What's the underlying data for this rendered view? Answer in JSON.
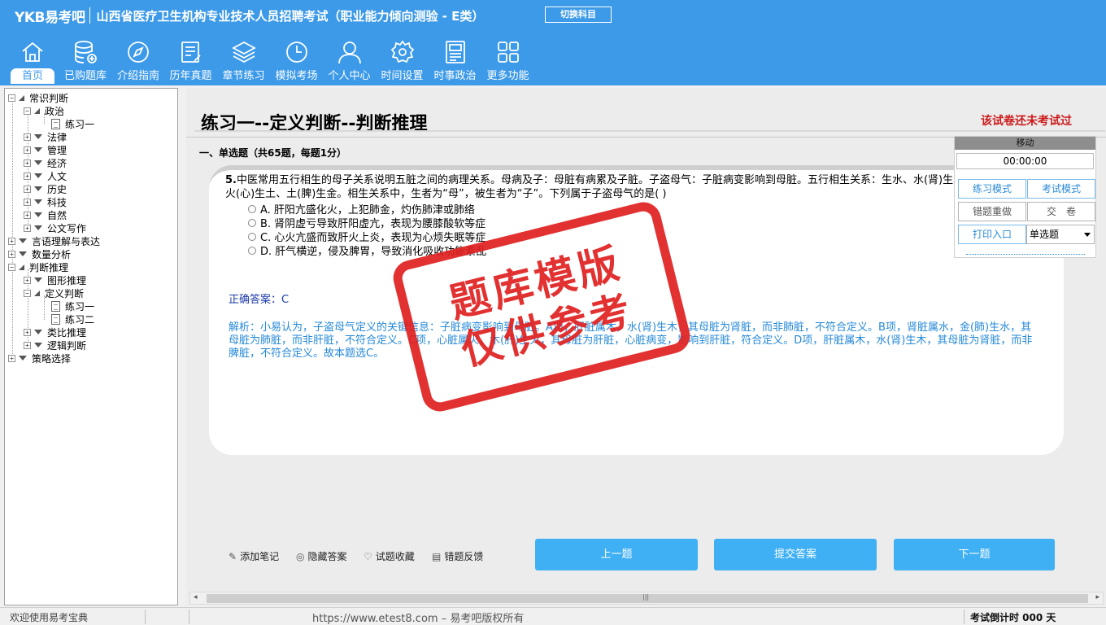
{
  "header": {
    "logo": "YKB易考吧",
    "title": "山西省医疗卫生机构专业技术人员招聘考试（职业能力倾向测验 - E类）",
    "switch_button": "切换科目"
  },
  "nav": [
    {
      "label": "首页",
      "icon": "home-icon"
    },
    {
      "label": "已购题库",
      "icon": "database-icon"
    },
    {
      "label": "介绍指南",
      "icon": "compass-icon"
    },
    {
      "label": "历年真题",
      "icon": "document-icon"
    },
    {
      "label": "章节练习",
      "icon": "layers-icon"
    },
    {
      "label": "模拟考场",
      "icon": "clock-icon"
    },
    {
      "label": "个人中心",
      "icon": "user-icon"
    },
    {
      "label": "时间设置",
      "icon": "gear-icon"
    },
    {
      "label": "时事政治",
      "icon": "newspaper-icon"
    },
    {
      "label": "更多功能",
      "icon": "grid-icon"
    }
  ],
  "tree": [
    {
      "label": "常识判断",
      "level": 0,
      "state": "open"
    },
    {
      "label": "政治",
      "level": 1,
      "state": "open"
    },
    {
      "label": "练习一",
      "level": 2,
      "state": "leaf"
    },
    {
      "label": "法律",
      "level": 1,
      "state": "closed"
    },
    {
      "label": "管理",
      "level": 1,
      "state": "closed"
    },
    {
      "label": "经济",
      "level": 1,
      "state": "closed"
    },
    {
      "label": "人文",
      "level": 1,
      "state": "closed"
    },
    {
      "label": "历史",
      "level": 1,
      "state": "closed"
    },
    {
      "label": "科技",
      "level": 1,
      "state": "closed"
    },
    {
      "label": "自然",
      "level": 1,
      "state": "closed"
    },
    {
      "label": "公文写作",
      "level": 1,
      "state": "closed"
    },
    {
      "label": "言语理解与表达",
      "level": 0,
      "state": "closed"
    },
    {
      "label": "数量分析",
      "level": 0,
      "state": "closed"
    },
    {
      "label": "判断推理",
      "level": 0,
      "state": "open"
    },
    {
      "label": "图形推理",
      "level": 1,
      "state": "closed"
    },
    {
      "label": "定义判断",
      "level": 1,
      "state": "open"
    },
    {
      "label": "练习一",
      "level": 2,
      "state": "leaf"
    },
    {
      "label": "练习二",
      "level": 2,
      "state": "leaf"
    },
    {
      "label": "类比推理",
      "level": 1,
      "state": "closed"
    },
    {
      "label": "逻辑判断",
      "level": 1,
      "state": "closed"
    },
    {
      "label": "策略选择",
      "level": 0,
      "state": "closed"
    }
  ],
  "paper": {
    "title": "练习一--定义判断--判断推理",
    "status": "该试卷还未考试过",
    "section": "一、单选题（共65题，每题1分）"
  },
  "question": {
    "number": "5.",
    "stem": "中医常用五行相生的母子关系说明五脏之间的病理关系。母病及子：母脏有病累及子脏。子盗母气：子脏病变影响到母脏。五行相生关系：生水、水(肾)生木、木(肝)生火、火(心)生土、土(脾)生金。相生关系中，生者为“母”，被生者为“子”。下列属于子盗母气的是( )",
    "options": [
      "A. 肝阳亢盛化火，上犯肺金，灼伤肺津或肺络",
      "B. 肾阴虚亏导致肝阳虚亢，表现为腰膝酸软等症",
      "C. 心火亢盛而致肝火上炎，表现为心烦失眠等症",
      "D. 肝气横逆，侵及脾胃，导致消化吸收功能紊乱"
    ],
    "answer": "正确答案：C",
    "analysis": "解析：小易认为，子盗母气定义的关键信息：子脏病变影响到母脏。A项，肝脏属木，水(肾)生木，其母脏为肾脏，而非肺脏，不符合定义。B项，肾脏属水，金(肺)生水，其母脏为肺脏，而非肝脏，不符合定义。C项，心脏属火，木(肝)生火，其母脏为肝脏，心脏病变，影响到肝脏，符合定义。D项，肝脏属木，水(肾)生木，其母脏为肾脏，而非脾脏，不符合定义。故本题选C。"
  },
  "stamp": {
    "line1": "题库模版",
    "line2": "仅供参考"
  },
  "actions": {
    "add_note": "添加笔记",
    "hide_answer": "隐藏答案",
    "favorite": "试题收藏",
    "feedback": "错题反馈"
  },
  "buttons": {
    "prev": "上一题",
    "submit": "提交答案",
    "next": "下一题"
  },
  "timer": {
    "header": "移动",
    "time": "00:00:00",
    "practice_mode": "练习模式",
    "exam_mode": "考试模式",
    "redo_wrong": "错题重做",
    "submit_paper": "交　卷",
    "print": "打印入口",
    "question_type": "单选题"
  },
  "status": {
    "welcome": "欢迎使用易考宝典",
    "url": "https://www.etest8.com – 易考吧版权所有",
    "countdown": "考试倒计时 000 天"
  }
}
